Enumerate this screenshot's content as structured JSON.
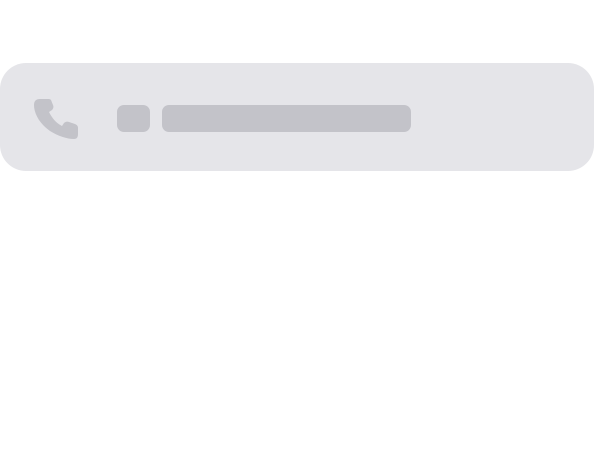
{
  "phone_card": {
    "icon": "phone-icon",
    "prefix_text": "",
    "number_text": "",
    "state": "loading-skeleton"
  },
  "colors": {
    "page_background": "#ffffff",
    "card_background": "#e5e5e9",
    "placeholder": "#c3c3c9",
    "icon": "#c3c3c9"
  }
}
